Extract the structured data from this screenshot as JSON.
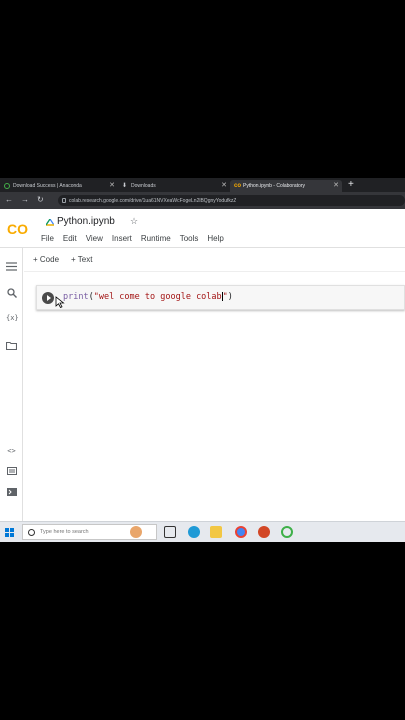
{
  "browser": {
    "tabs": [
      {
        "title": "Download Success | Anaconda",
        "active": false
      },
      {
        "title": "Downloads",
        "active": false
      },
      {
        "title": "Python.ipynb - Colaboratory",
        "active": true
      }
    ],
    "new_tab_label": "+",
    "url": "colab.research.google.com/drive/1ua61NVXeaWcFogeLn2lBQgnyYodufkzZ"
  },
  "colab": {
    "logo_text": "CO",
    "notebook_title": "Python.ipynb",
    "menu": [
      "File",
      "Edit",
      "View",
      "Insert",
      "Runtime",
      "Tools",
      "Help"
    ],
    "toolbar": {
      "code_label": "+ Code",
      "text_label": "+ Text"
    },
    "rail_icons": [
      "toc-icon",
      "search-icon",
      "variables-icon",
      "files-icon",
      "code-snippets-icon",
      "command-palette-icon",
      "terminal-icon"
    ],
    "cell": {
      "keyword": "print",
      "open": "(",
      "string": "\"wel come to google colab",
      "close_quote": "\"",
      "close": ")"
    }
  },
  "taskbar": {
    "search_placeholder": "Type here to search"
  },
  "colors": {
    "colab_orange": "#f9ab00",
    "chrome_dark": "#202124"
  }
}
